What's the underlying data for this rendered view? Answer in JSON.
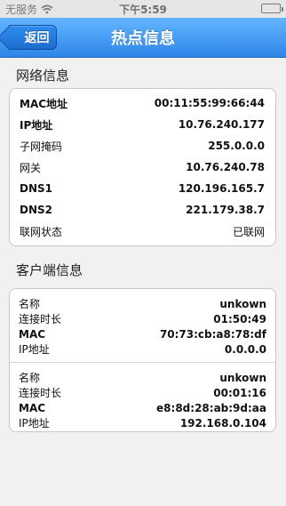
{
  "statusbar": {
    "carrier": "无服务",
    "wifi_icon": "wifi-icon",
    "time": "下午5:59",
    "battery_icon": "battery-icon",
    "battery_level": 0.0
  },
  "nav": {
    "back_label": "返回",
    "title": "热点信息"
  },
  "network": {
    "section_title": "网络信息",
    "rows": [
      {
        "key": "MAC地址",
        "value": "00:11:55:99:66:44"
      },
      {
        "key": "IP地址",
        "value": "10.76.240.177"
      },
      {
        "key": "子网掩码",
        "value": "255.0.0.0"
      },
      {
        "key": "网关",
        "value": "10.76.240.78"
      },
      {
        "key": "DNS1",
        "value": "120.196.165.7"
      },
      {
        "key": "DNS2",
        "value": "221.179.38.7"
      },
      {
        "key": "联网状态",
        "value": "已联网"
      }
    ]
  },
  "clients": {
    "section_title": "客户端信息",
    "items": [
      {
        "name_label": "名称",
        "name": "unkown",
        "duration_label": "连接时长",
        "duration": "01:50:49",
        "mac_label": "MAC",
        "mac": "70:73:cb:a8:78:df",
        "ip_label": "IP地址",
        "ip": "0.0.0.0"
      },
      {
        "name_label": "名称",
        "name": "unkown",
        "duration_label": "连接时长",
        "duration": "00:01:16",
        "mac_label": "MAC",
        "mac": "e8:8d:28:ab:9d:aa",
        "ip_label": "IP地址",
        "ip": "192.168.0.104"
      }
    ]
  },
  "colors": {
    "nav_top": "#63b5ff",
    "nav_bottom": "#2f86e8",
    "page_bg": "#f1f1f1"
  }
}
